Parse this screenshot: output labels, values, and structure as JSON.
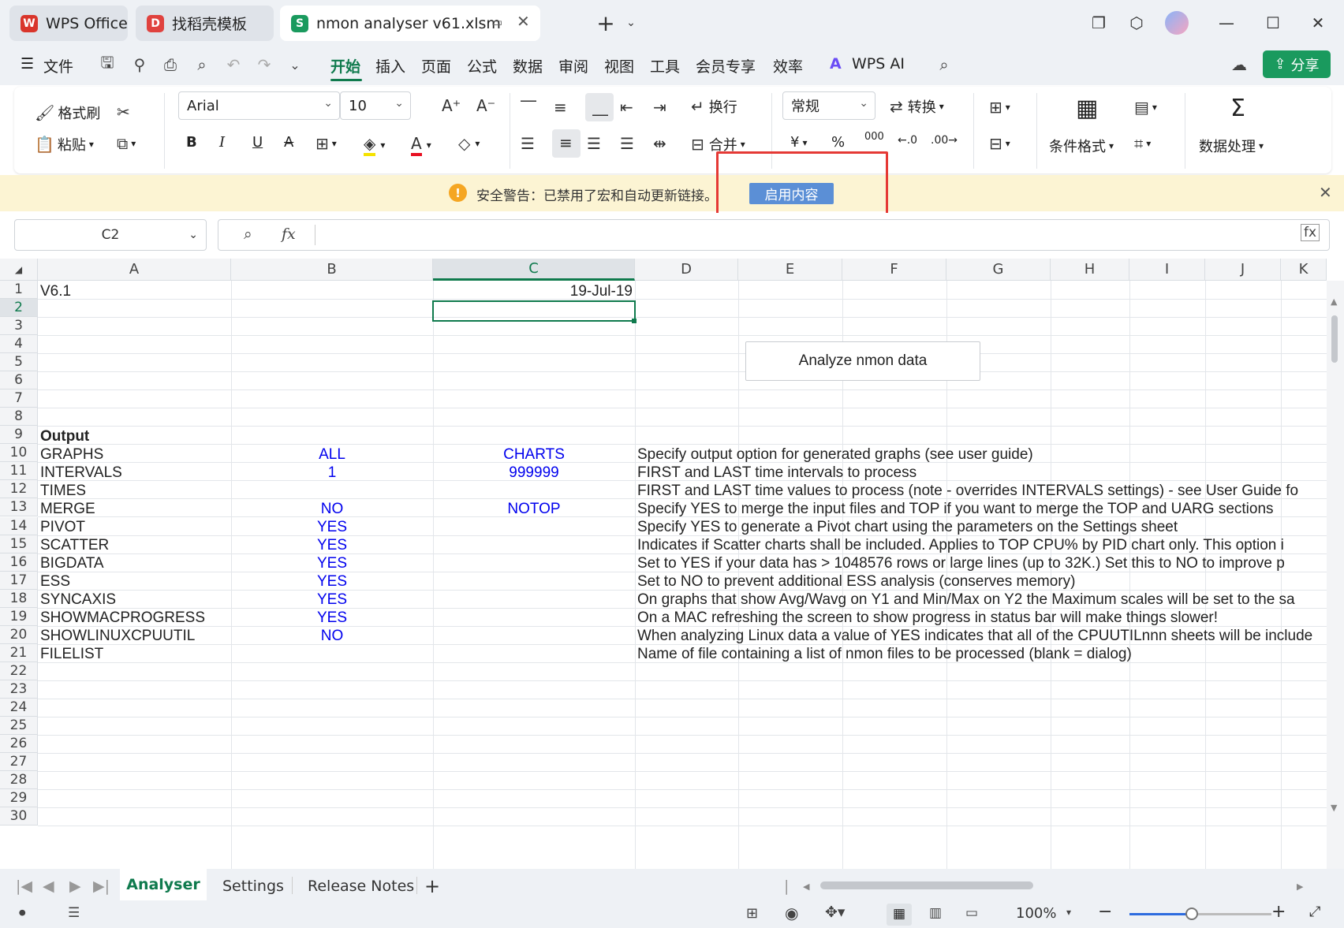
{
  "titlebar": {
    "tabs": [
      {
        "label": "WPS Office",
        "color": "#d9352b"
      },
      {
        "label": "找稻壳模板",
        "color": "#e0423e"
      },
      {
        "label": "nmon analyser v61.xlsm",
        "color": "#1a9a5e",
        "glyph": "S"
      }
    ],
    "new_tab": "+"
  },
  "menu": {
    "file": "文件",
    "items": [
      "开始",
      "插入",
      "页面",
      "公式",
      "数据",
      "审阅",
      "视图",
      "工具",
      "会员专享",
      "效率"
    ],
    "selected": "开始",
    "wps_ai": "WPS AI",
    "share": "分享"
  },
  "ribbon": {
    "format_painter": "格式刷",
    "paste": "粘贴",
    "font_name": "Arial",
    "font_size": "10",
    "bold": "B",
    "italic": "I",
    "underline": "U",
    "wrap": "换行",
    "merge": "合并",
    "number_format": "常规",
    "convert": "转换",
    "conditional_format": "条件格式",
    "data_processing": "数据处理",
    "currency": "¥",
    "percent": "%",
    "thousands": "000"
  },
  "security": {
    "message": "安全警告：已禁用了宏和自动更新链接。",
    "button": "启用内容"
  },
  "formula": {
    "name_box": "C2",
    "fx": "fx",
    "value": ""
  },
  "columns": [
    "A",
    "B",
    "C",
    "D",
    "E",
    "F",
    "G",
    "H",
    "I",
    "J",
    "K"
  ],
  "rows": [
    "1",
    "2",
    "3",
    "4",
    "5",
    "6",
    "7",
    "8",
    "9",
    "10",
    "11",
    "12",
    "13",
    "14",
    "15",
    "16",
    "17",
    "18",
    "19",
    "20",
    "21",
    "22",
    "23",
    "24",
    "25",
    "26",
    "27",
    "28",
    "29",
    "30"
  ],
  "cells": {
    "A1": "V6.1",
    "C1": "19-Jul-19",
    "A9": "Output",
    "A10": "GRAPHS",
    "B10": "ALL",
    "C10": "CHARTS",
    "D10": "Specify output option for generated graphs (see user guide)",
    "A11": "INTERVALS",
    "B11": "1",
    "C11": "999999",
    "D11": "FIRST and LAST time intervals to process",
    "A12": "TIMES",
    "D12": "FIRST and LAST time values to process (note - overrides INTERVALS settings) - see User Guide fo",
    "A13": "MERGE",
    "B13": "NO",
    "C13": "NOTOP",
    "D13": "Specify YES to merge the input files and TOP if you want to merge the TOP and UARG sections",
    "A14": "PIVOT",
    "B14": "YES",
    "D14": "Specify YES to generate a Pivot chart using the parameters on the Settings sheet",
    "A15": "SCATTER",
    "B15": "YES",
    "D15": "Indicates if Scatter charts shall be included.  Applies to TOP CPU% by PID chart only.  This option i",
    "A16": "BIGDATA",
    "B16": "YES",
    "D16": "Set to YES if your data has > 1048576 rows or large lines (up to 32K.)  Set this to NO to improve p",
    "A17": "ESS",
    "B17": "YES",
    "D17": "Set to NO to prevent additional ESS analysis (conserves memory)",
    "A18": "SYNCAXIS",
    "B18": "YES",
    "D18": "On graphs that show Avg/Wavg on Y1 and Min/Max on Y2 the Maximum scales will be set to the sa",
    "A19": "SHOWMACPROGRESS",
    "B19": "YES",
    "D19": "On a MAC refreshing the screen to show progress in status bar will make things slower!",
    "A20": "SHOWLINUXCPUUTIL",
    "B20": "NO",
    "D20": "When analyzing Linux data a value of YES indicates that all of the CPUUTILnnn sheets will be include",
    "A21": "FILELIST",
    "D21": "Name of file containing a list of nmon files to be processed (blank = dialog)"
  },
  "analyze_button": "Analyze nmon data",
  "sheets": [
    "Analyser",
    "Settings",
    "Release Notes"
  ],
  "active_sheet": "Analyser",
  "zoom": "100%",
  "accent_color": "#0f7a4d"
}
